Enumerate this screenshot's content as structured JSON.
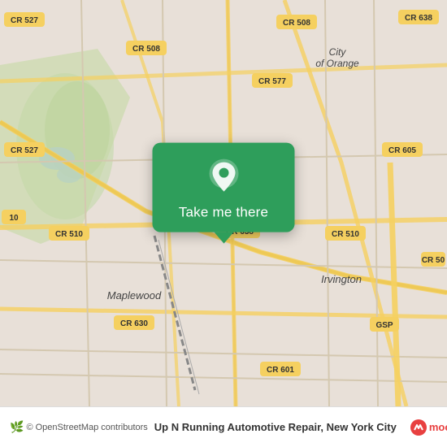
{
  "map": {
    "attribution": "© OpenStreetMap contributors",
    "osm_leaf": "🌿",
    "background_color": "#e8e0d8"
  },
  "popup": {
    "label": "Take me there",
    "pin_icon": "location-pin",
    "background_color": "#2e9e5b"
  },
  "bottom_bar": {
    "osm_label": "© OpenStreetMap contributors",
    "place_name": "Up N Running Automotive Repair, New York City",
    "moovit_text": "moovit"
  },
  "road_labels": [
    "CR 638",
    "CR 527",
    "CR 508",
    "CR 577",
    "CR 527",
    "CR 508",
    "CR 510",
    "CR 638",
    "CR 510",
    "CR 605",
    "CR 630",
    "CR 601",
    "GSP",
    "CR 50"
  ],
  "place_labels": [
    "City of Orange",
    "Maplewood",
    "Irvington"
  ]
}
